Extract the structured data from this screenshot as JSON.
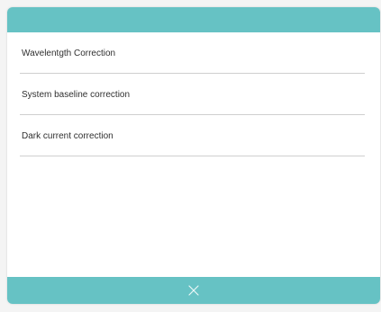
{
  "menu": {
    "items": [
      {
        "label": "Wavelentgth Correction"
      },
      {
        "label": "System baseline correction"
      },
      {
        "label": "Dark current correction"
      }
    ]
  },
  "footer": {
    "close_icon": "close-icon"
  },
  "colors": {
    "accent": "#66c2c4",
    "divider": "#cfcfcf",
    "text": "#2f2f2f",
    "background": "#ffffff"
  }
}
